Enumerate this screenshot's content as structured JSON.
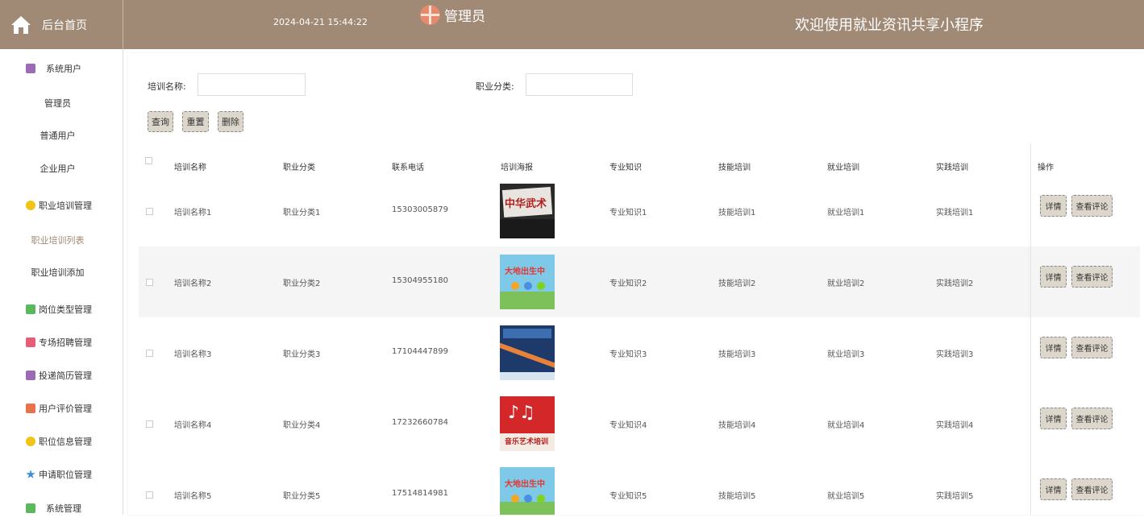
{
  "header": {
    "home_label": "后台首页",
    "datetime": "2024-04-21 15:44:22",
    "admin_label": "管理员",
    "welcome": "欢迎使用就业资讯共享小程序",
    "bg_color": "#a08a75"
  },
  "sidebar": {
    "items": [
      {
        "label": "系统用户",
        "icon": "user-group-icon",
        "color": "#9b6bb5"
      },
      {
        "label": "管理员"
      },
      {
        "label": "普通用户"
      },
      {
        "label": "企业用户"
      },
      {
        "label": "职业培训管理",
        "icon": "cube-icon",
        "color": "#f0c419"
      },
      {
        "label": "职业培训列表",
        "active": true
      },
      {
        "label": "职业培训添加"
      },
      {
        "label": "岗位类型管理",
        "icon": "chat-icon",
        "color": "#5cb85c"
      },
      {
        "label": "专场招聘管理",
        "icon": "card-icon",
        "color": "#e85d75"
      },
      {
        "label": "投递简历管理",
        "icon": "archive-icon",
        "color": "#9b6bb5"
      },
      {
        "label": "用户评价管理",
        "icon": "grid-icon",
        "color": "#e8734a"
      },
      {
        "label": "职位信息管理",
        "icon": "cube-icon",
        "color": "#f0c419"
      },
      {
        "label": "申请职位管理",
        "icon": "star-icon",
        "color": "#3b8fd9"
      },
      {
        "label": "系统管理",
        "icon": "chat-icon",
        "color": "#5cb85c"
      }
    ]
  },
  "search": {
    "name_label": "培训名称:",
    "category_label": "职业分类:",
    "name_value": "",
    "category_value": ""
  },
  "buttons": {
    "query": "查询",
    "reset": "重置",
    "delete": "删除"
  },
  "table": {
    "headers": [
      "培训名称",
      "职业分类",
      "联系电话",
      "培训海报",
      "专业知识",
      "技能培训",
      "就业培训",
      "实践培训",
      "操作"
    ],
    "rows": [
      {
        "name": "培训名称1",
        "category": "职业分类1",
        "phone": "15303005879",
        "knowledge": "专业知识1",
        "skill": "技能培训1",
        "employment": "就业培训1",
        "practice": "实践培训1",
        "poster_text": "中华武术"
      },
      {
        "name": "培训名称2",
        "category": "职业分类2",
        "phone": "15304955180",
        "knowledge": "专业知识2",
        "skill": "技能培训2",
        "employment": "就业培训2",
        "practice": "实践培训2",
        "poster_text": "大地出生中"
      },
      {
        "name": "培训名称3",
        "category": "职业分类3",
        "phone": "17104447899",
        "knowledge": "专业知识3",
        "skill": "技能培训3",
        "employment": "就业培训3",
        "practice": "实践培训3",
        "poster_text": ""
      },
      {
        "name": "培训名称4",
        "category": "职业分类4",
        "phone": "17232660784",
        "knowledge": "专业知识4",
        "skill": "技能培训4",
        "employment": "就业培训4",
        "practice": "实践培训4",
        "poster_text": "音乐艺术培训"
      },
      {
        "name": "培训名称5",
        "category": "职业分类5",
        "phone": "17514814981",
        "knowledge": "专业知识5",
        "skill": "技能培训5",
        "employment": "就业培训5",
        "practice": "实践培训5",
        "poster_text": "大地出生中"
      }
    ],
    "detail_label": "详情",
    "comment_label": "查看评论"
  }
}
